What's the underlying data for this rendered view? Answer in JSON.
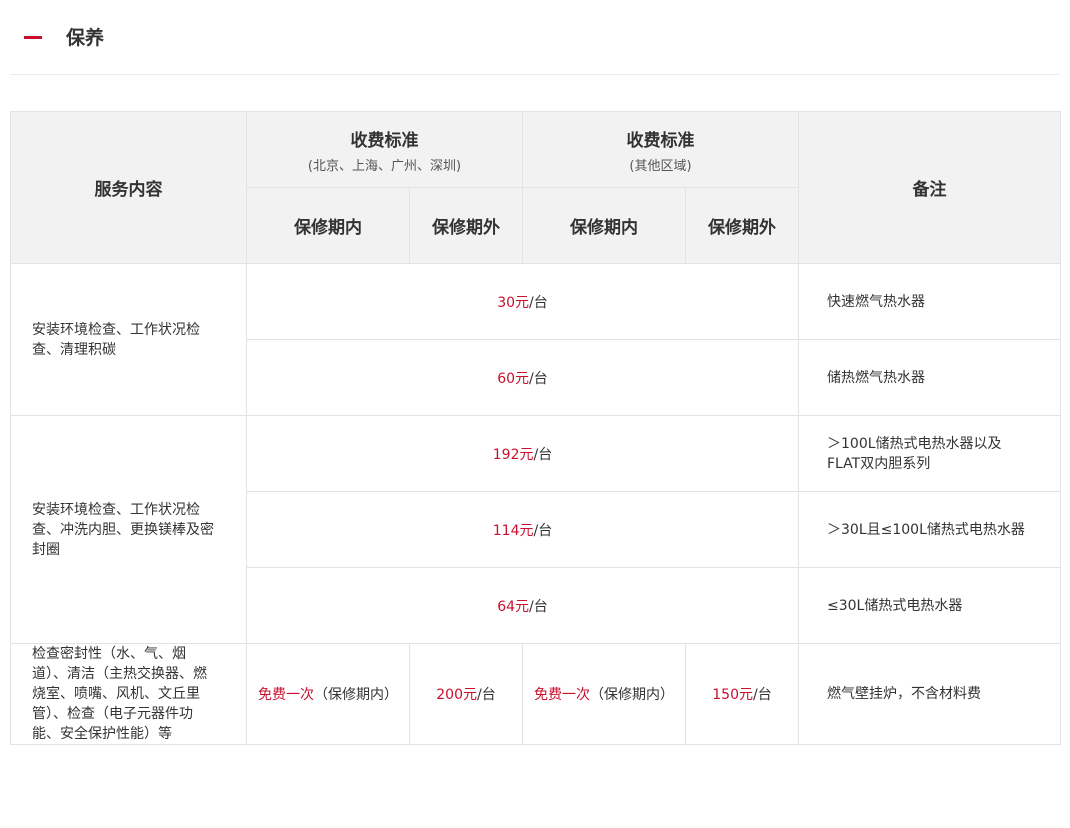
{
  "section": {
    "title": "保养"
  },
  "table": {
    "headers": {
      "service": "服务内容",
      "group1_title": "收费标准",
      "group1_note": "(北京、上海、广州、深圳)",
      "group2_title": "收费标准",
      "group2_note": "(其他区域)",
      "in_warranty": "保修期内",
      "out_warranty": "保修期外",
      "remark": "备注"
    },
    "unit": "/台",
    "rows": [
      {
        "service": "安装环境检查、工作状况检查、清理积碳",
        "price": "30元",
        "remark": "快速燃气热水器"
      },
      {
        "price": "60元",
        "remark": "储热燃气热水器"
      },
      {
        "service": "安装环境检查、工作状况检查、冲洗内胆、更换镁棒及密封圈",
        "price": "192元",
        "remark": "＞100L储热式电热水器以及FLAT双内胆系列"
      },
      {
        "price": "114元",
        "remark": "＞30L且≤100L储热式电热水器"
      },
      {
        "price": "64元",
        "remark": "≤30L储热式电热水器"
      },
      {
        "service": "检查密封性（水、气、烟道）、清洁（主热交换器、燃烧室、喷嘴、风机、文丘里管）、检查（电子元器件功能、安全保护性能）等",
        "g1_in_free": "免费一次",
        "g1_in_note": "（保修期内）",
        "g1_out": "200元",
        "g2_in_free": "免费一次",
        "g2_in_note": "（保修期内）",
        "g2_out": "150元",
        "remark": "燃气壁挂炉，不含材料费"
      }
    ]
  },
  "colors": {
    "accent": "#c8102e",
    "header_bg": "#f2f2f2",
    "border": "#e3e3e3"
  }
}
